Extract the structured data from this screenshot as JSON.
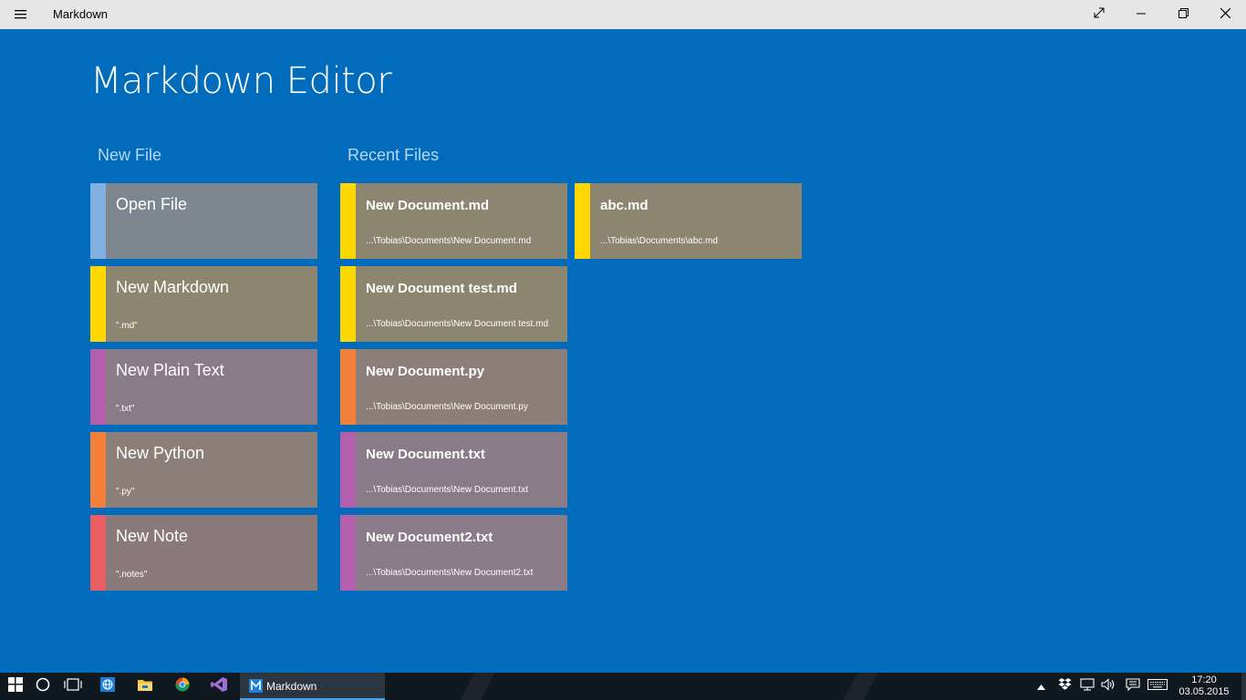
{
  "window": {
    "title": "Markdown"
  },
  "page": {
    "title": "Markdown Editor"
  },
  "new_file": {
    "heading": "New File",
    "tiles": [
      {
        "title": "Open File",
        "subtitle": "",
        "stripe_color": "#7fb0e0",
        "bg_color": "#7e8790"
      },
      {
        "title": "New Markdown",
        "subtitle": "\".md\"",
        "stripe_color": "#ffd700",
        "bg_color": "#8c8570"
      },
      {
        "title": "New Plain Text",
        "subtitle": "\".txt\"",
        "stripe_color": "#b35fae",
        "bg_color": "#8a7b88"
      },
      {
        "title": "New Python",
        "subtitle": "\".py\"",
        "stripe_color": "#f47f3b",
        "bg_color": "#8c7e78"
      },
      {
        "title": "New Note",
        "subtitle": "\".notes\"",
        "stripe_color": "#e85e62",
        "bg_color": "#8b7a7c"
      }
    ]
  },
  "recent_files": {
    "heading": "Recent Files",
    "col1": [
      {
        "title": "New Document.md",
        "path": "...\\Tobias\\Documents\\New Document.md",
        "stripe_color": "#ffd700",
        "bg_color": "#8c8570"
      },
      {
        "title": "New Document test.md",
        "path": "...\\Tobias\\Documents\\New Document test.md",
        "stripe_color": "#ffd700",
        "bg_color": "#8c8570"
      },
      {
        "title": "New Document.py",
        "path": "...\\Tobias\\Documents\\New Document.py",
        "stripe_color": "#f47f3b",
        "bg_color": "#8c7e78"
      },
      {
        "title": "New Document.txt",
        "path": "...\\Tobias\\Documents\\New Document.txt",
        "stripe_color": "#b35fae",
        "bg_color": "#8a7b88"
      },
      {
        "title": "New Document2.txt",
        "path": "...\\Tobias\\Documents\\New Document2.txt",
        "stripe_color": "#b35fae",
        "bg_color": "#8a7b88"
      }
    ],
    "col2": [
      {
        "title": "abc.md",
        "path": "...\\Tobias\\Documents\\abc.md",
        "stripe_color": "#ffd700",
        "bg_color": "#8c8570"
      }
    ]
  },
  "taskbar": {
    "active_app": "Markdown",
    "time": "17:20",
    "date": "03.05.2015"
  },
  "colors": {
    "background": "#006cbb",
    "titlebar": "#e6e6e6",
    "section_heading": "#b7d7f3",
    "taskbar": "#101820"
  }
}
